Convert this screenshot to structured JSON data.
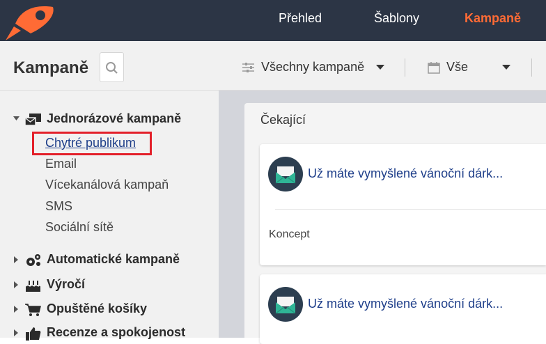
{
  "topnav": {
    "items": [
      {
        "label": "Přehled",
        "active": false
      },
      {
        "label": "Šablony",
        "active": false
      },
      {
        "label": "Kampaně",
        "active": true
      }
    ]
  },
  "header": {
    "title": "Kampaně",
    "filter_campaigns": "Všechny kampaně",
    "filter_date": "Vše",
    "icons": [
      "search-icon",
      "sliders-icon",
      "calendar-icon",
      "caret-down-icon"
    ]
  },
  "sidebar": {
    "categories": [
      {
        "label": "Jednorázové kampaně",
        "expanded": true,
        "icon": "campaign-mail-icon",
        "items": [
          "Chytré publikum",
          "Email",
          "Vícekanálová kampaň",
          "SMS",
          "Sociální sítě"
        ]
      },
      {
        "label": "Automatické kampaně",
        "expanded": false,
        "icon": "gears-icon"
      },
      {
        "label": "Výročí",
        "expanded": false,
        "icon": "cake-icon"
      },
      {
        "label": "Opuštěné košíky",
        "expanded": false,
        "icon": "cart-icon"
      },
      {
        "label": "Recenze a spokojenost",
        "expanded": false,
        "icon": "thumbs-up-icon"
      }
    ]
  },
  "main": {
    "panel_title": "Čekající",
    "cards": [
      {
        "title": "Už máte vymyšlené vánoční dárk...",
        "status": "Koncept",
        "icon": "email-envelope-icon"
      },
      {
        "title": "Už máte vymyšlené vánoční dárk...",
        "status": "",
        "icon": "email-envelope-icon"
      }
    ]
  },
  "colors": {
    "nav_bg": "#2c3545",
    "accent": "#ff6b35",
    "link": "#1f3f8a",
    "highlight_box": "#e3202a",
    "icon_circle": "#2c3e50",
    "icon_mail": "#2fb596"
  }
}
